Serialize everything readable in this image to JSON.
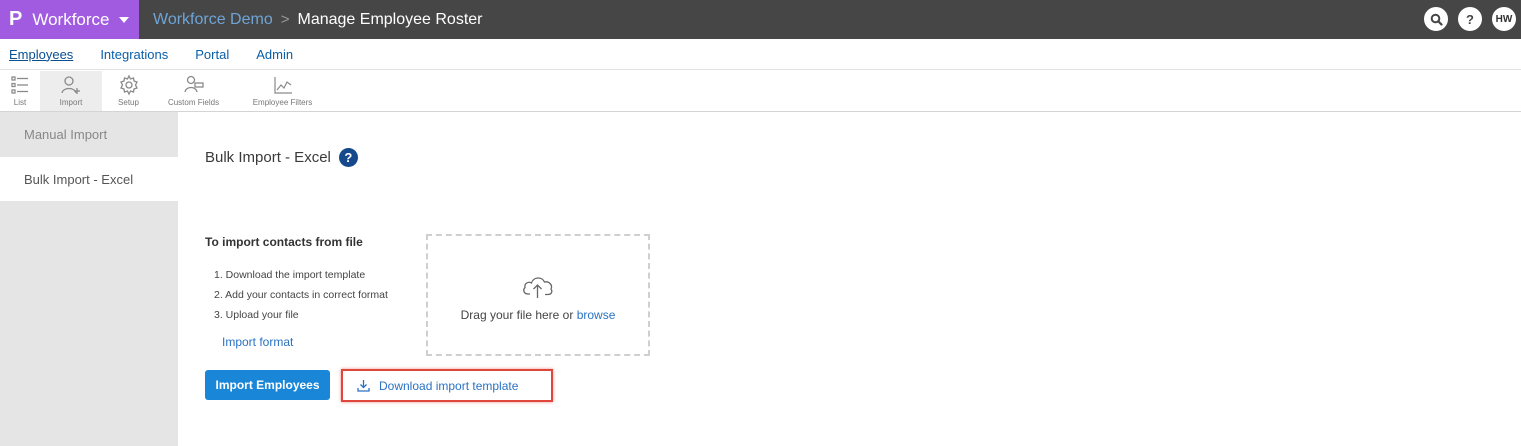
{
  "app": {
    "logo": "P",
    "product_name": "Workforce",
    "breadcrumb": {
      "workspace": "Workforce Demo",
      "page": "Manage Employee Roster"
    },
    "avatar_initials": "HW",
    "colors": {
      "topbar": "#464646",
      "product": "#a05be0",
      "primary_button": "#1a86d8",
      "highlight": "#e0473c"
    }
  },
  "main_nav": [
    "Employees",
    "Integrations",
    "Portal",
    "Admin"
  ],
  "toolbar": [
    {
      "label": "List",
      "icon": "list-icon"
    },
    {
      "label": "Import",
      "icon": "add-user-icon"
    },
    {
      "label": "Setup",
      "icon": "gear-icon"
    },
    {
      "label": "Custom Fields",
      "icon": "user-field-icon"
    },
    {
      "label": "Employee Filters",
      "icon": "chart-filter-icon"
    }
  ],
  "sidebar": [
    "Manual Import",
    "Bulk Import - Excel"
  ],
  "content": {
    "title": "Bulk Import - Excel",
    "help": "?",
    "instructions_heading": "To import contacts from file",
    "steps": [
      "1. Download the import template",
      "2. Add your contacts in correct format",
      "3. Upload your file"
    ],
    "import_format_link": "Import format",
    "dropzone_text": "Drag your file here or",
    "browse_link": "browse",
    "import_button": "Import Employees",
    "download_button": "Download import template"
  }
}
